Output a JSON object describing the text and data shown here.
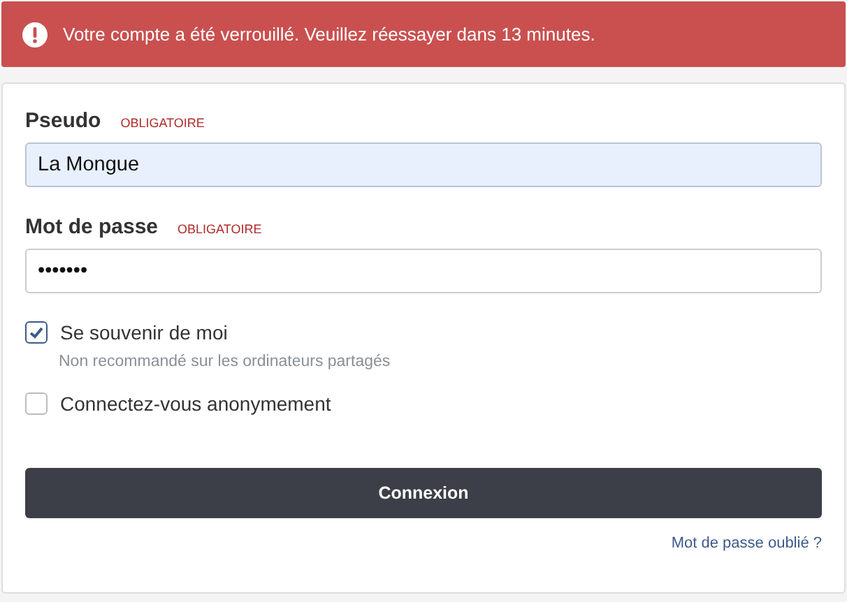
{
  "alert": {
    "message": "Votre compte a été verrouillé. Veuillez réessayer dans 13 minutes."
  },
  "fields": [
    {
      "label": "Pseudo",
      "required": "OBLIGATOIRE",
      "value": "La Mongue",
      "autofilled": true
    },
    {
      "label": "Mot de passe",
      "required": "OBLIGATOIRE",
      "value": "•••••••",
      "autofilled": false
    }
  ],
  "options": [
    {
      "label": "Se souvenir de moi",
      "checked": true,
      "hint": "Non recommandé sur les ordinateurs partagés"
    },
    {
      "label": "Connectez-vous anonymement",
      "checked": false
    }
  ],
  "submit": "Connexion",
  "forgot_link": "Mot de passe oublié ?"
}
